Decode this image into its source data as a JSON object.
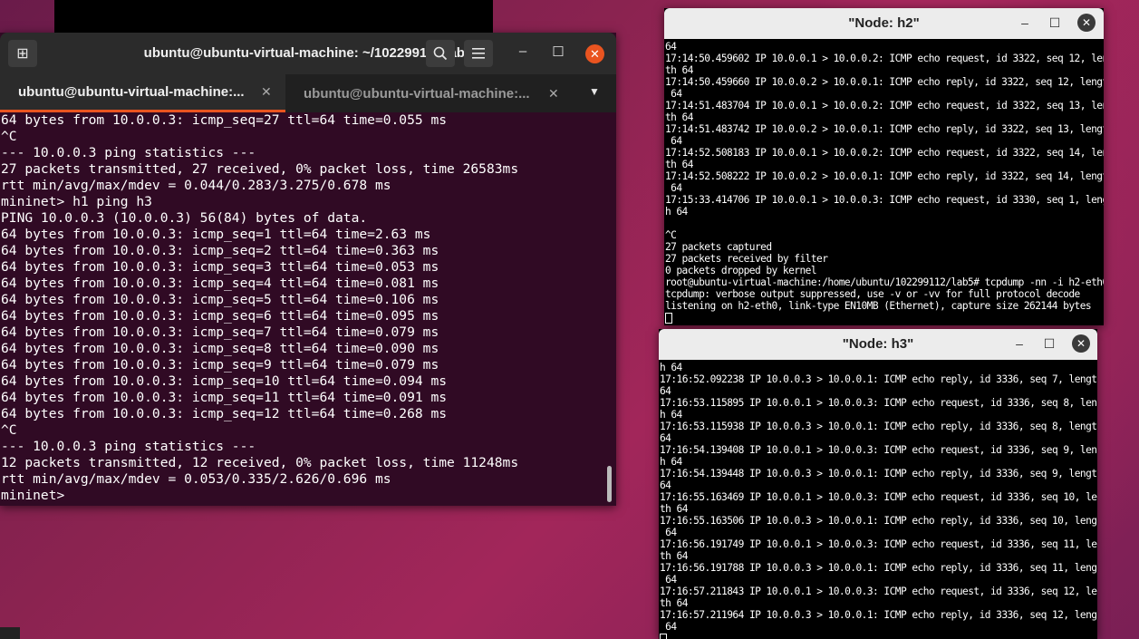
{
  "terminal": {
    "title": "ubuntu@ubuntu-virtual-machine: ~/102299112/lab5",
    "tabs": [
      {
        "label": "ubuntu@ubuntu-virtual-machine:..."
      },
      {
        "label": "ubuntu@ubuntu-virtual-machine:..."
      }
    ],
    "lines": [
      "64 bytes from 10.0.0.3: icmp_seq=27 ttl=64 time=0.055 ms",
      "^C",
      "--- 10.0.0.3 ping statistics ---",
      "27 packets transmitted, 27 received, 0% packet loss, time 26583ms",
      "rtt min/avg/max/mdev = 0.044/0.283/3.275/0.678 ms",
      "mininet> h1 ping h3",
      "PING 10.0.0.3 (10.0.0.3) 56(84) bytes of data.",
      "64 bytes from 10.0.0.3: icmp_seq=1 ttl=64 time=2.63 ms",
      "64 bytes from 10.0.0.3: icmp_seq=2 ttl=64 time=0.363 ms",
      "64 bytes from 10.0.0.3: icmp_seq=3 ttl=64 time=0.053 ms",
      "64 bytes from 10.0.0.3: icmp_seq=4 ttl=64 time=0.081 ms",
      "64 bytes from 10.0.0.3: icmp_seq=5 ttl=64 time=0.106 ms",
      "64 bytes from 10.0.0.3: icmp_seq=6 ttl=64 time=0.095 ms",
      "64 bytes from 10.0.0.3: icmp_seq=7 ttl=64 time=0.079 ms",
      "64 bytes from 10.0.0.3: icmp_seq=8 ttl=64 time=0.090 ms",
      "64 bytes from 10.0.0.3: icmp_seq=9 ttl=64 time=0.079 ms",
      "64 bytes from 10.0.0.3: icmp_seq=10 ttl=64 time=0.094 ms",
      "64 bytes from 10.0.0.3: icmp_seq=11 ttl=64 time=0.091 ms",
      "64 bytes from 10.0.0.3: icmp_seq=12 ttl=64 time=0.268 ms",
      "^C",
      "--- 10.0.0.3 ping statistics ---",
      "12 packets transmitted, 12 received, 0% packet loss, time 11248ms",
      "rtt min/avg/max/mdev = 0.053/0.335/2.626/0.696 ms",
      "mininet> "
    ]
  },
  "node_h2": {
    "title": "\"Node: h2\"",
    "lines": [
      "64",
      "17:14:50.459602 IP 10.0.0.1 > 10.0.0.2: ICMP echo request, id 3322, seq 12, leng",
      "th 64",
      "17:14:50.459660 IP 10.0.0.2 > 10.0.0.1: ICMP echo reply, id 3322, seq 12, length",
      " 64",
      "17:14:51.483704 IP 10.0.0.1 > 10.0.0.2: ICMP echo request, id 3322, seq 13, leng",
      "th 64",
      "17:14:51.483742 IP 10.0.0.2 > 10.0.0.1: ICMP echo reply, id 3322, seq 13, length",
      " 64",
      "17:14:52.508183 IP 10.0.0.1 > 10.0.0.2: ICMP echo request, id 3322, seq 14, leng",
      "th 64",
      "17:14:52.508222 IP 10.0.0.2 > 10.0.0.1: ICMP echo reply, id 3322, seq 14, length",
      " 64",
      "17:15:33.414706 IP 10.0.0.1 > 10.0.0.3: ICMP echo request, id 3330, seq 1, lengt",
      "h 64",
      "",
      "^C",
      "27 packets captured",
      "27 packets received by filter",
      "0 packets dropped by kernel",
      "root@ubuntu-virtual-machine:/home/ubuntu/102299112/lab5# tcpdump -nn -i h2-eth0",
      "tcpdump: verbose output suppressed, use -v or -vv for full protocol decode",
      "listening on h2-eth0, link-type EN10MB (Ethernet), capture size 262144 bytes"
    ]
  },
  "node_h3": {
    "title": "\"Node: h3\"",
    "lines": [
      "h 64",
      "17:16:52.092238 IP 10.0.0.3 > 10.0.0.1: ICMP echo reply, id 3336, seq 7, length",
      "64",
      "17:16:53.115895 IP 10.0.0.1 > 10.0.0.3: ICMP echo request, id 3336, seq 8, lengt",
      "h 64",
      "17:16:53.115938 IP 10.0.0.3 > 10.0.0.1: ICMP echo reply, id 3336, seq 8, length",
      "64",
      "17:16:54.139408 IP 10.0.0.1 > 10.0.0.3: ICMP echo request, id 3336, seq 9, lengt",
      "h 64",
      "17:16:54.139448 IP 10.0.0.3 > 10.0.0.1: ICMP echo reply, id 3336, seq 9, length",
      "64",
      "17:16:55.163469 IP 10.0.0.1 > 10.0.0.3: ICMP echo request, id 3336, seq 10, leng",
      "th 64",
      "17:16:55.163506 IP 10.0.0.3 > 10.0.0.1: ICMP echo reply, id 3336, seq 10, length",
      " 64",
      "17:16:56.191749 IP 10.0.0.1 > 10.0.0.3: ICMP echo request, id 3336, seq 11, leng",
      "th 64",
      "17:16:56.191788 IP 10.0.0.3 > 10.0.0.1: ICMP echo reply, id 3336, seq 11, length",
      " 64",
      "17:16:57.211843 IP 10.0.0.1 > 10.0.0.3: ICMP echo request, id 3336, seq 12, leng",
      "th 64",
      "17:16:57.211964 IP 10.0.0.3 > 10.0.0.1: ICMP echo reply, id 3336, seq 12, length",
      " 64"
    ]
  },
  "icons": {
    "new_tab": "new-tab-icon",
    "search": "search-icon",
    "menu": "hamburger-menu-icon",
    "minimize": "minimize-icon",
    "maximize": "maximize-icon",
    "close": "close-icon",
    "tab_dropdown": "chevron-down-icon"
  },
  "colors": {
    "terminal_bg": "#300a24",
    "accent": "#e95420",
    "xterm_bg": "#000000"
  }
}
